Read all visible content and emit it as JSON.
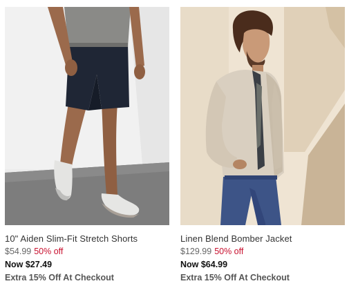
{
  "products": [
    {
      "name": "10\" Aiden Slim-Fit Stretch Shorts",
      "original_price": "$54.99",
      "discount": "50% off",
      "sale_price": "Now $27.49",
      "promo": "Extra 15% Off At Checkout"
    },
    {
      "name": "Linen Blend Bomber Jacket",
      "original_price": "$129.99",
      "discount": "50% off",
      "sale_price": "Now $64.99",
      "promo": "Extra 15% Off At Checkout"
    }
  ],
  "colors": {
    "discount_red": "#c8102e",
    "shorts_navy": "#1f2635",
    "jacket_beige": "#d9cfc0",
    "wall_cream": "#efe6d6"
  }
}
